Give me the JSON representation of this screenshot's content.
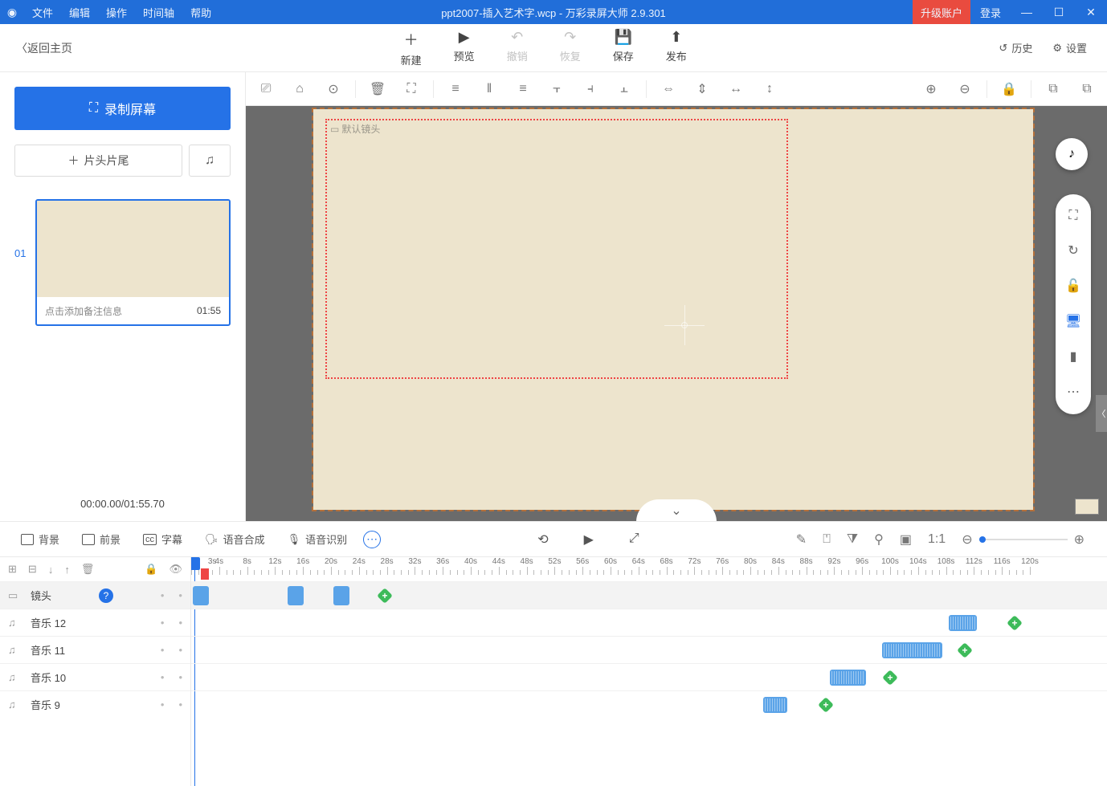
{
  "titlebar": {
    "menus": [
      "文件",
      "编辑",
      "操作",
      "时间轴",
      "帮助"
    ],
    "title": "ppt2007-插入艺术字.wcp - 万彩录屏大师 2.9.301",
    "upgrade": "升级账户",
    "login": "登录"
  },
  "maintb": {
    "back": "返回主页",
    "items": [
      {
        "icon": "＋",
        "label": "新建"
      },
      {
        "icon": "▶",
        "label": "预览"
      },
      {
        "icon": "↶",
        "label": "撤销",
        "disabled": true
      },
      {
        "icon": "↷",
        "label": "恢复",
        "disabled": true
      },
      {
        "icon": "💾",
        "label": "保存"
      },
      {
        "icon": "⬆",
        "label": "发布"
      }
    ],
    "history": "历史",
    "settings": "设置"
  },
  "left": {
    "record": "录制屏幕",
    "titles": "片头片尾",
    "scene_num": "01",
    "note_placeholder": "点击添加备注信息",
    "scene_time": "01:55",
    "time_status": "00:00.00/01:55.70"
  },
  "canvas": {
    "default_shot": "默认镜头"
  },
  "timeline": {
    "tabs": [
      "背景",
      "前景",
      "字幕",
      "语音合成",
      "语音识别"
    ],
    "ruler_labels": [
      "3s",
      "4s",
      "8s",
      "12s",
      "16s",
      "20s",
      "24s",
      "28s",
      "32s",
      "36s",
      "40s",
      "44s",
      "48s",
      "52s",
      "56s",
      "60s",
      "64s",
      "68s",
      "72s",
      "76s",
      "80s",
      "84s",
      "88s",
      "92s",
      "96s",
      "100s",
      "104s",
      "108s",
      "112s",
      "116s"
    ],
    "tracks": [
      {
        "icon": "cam",
        "name": "镜头",
        "first": true,
        "help": true
      },
      {
        "icon": "note",
        "name": "音乐 12"
      },
      {
        "icon": "note",
        "name": "音乐 11"
      },
      {
        "icon": "note",
        "name": "音乐 10"
      },
      {
        "icon": "note",
        "name": "音乐 9"
      }
    ]
  }
}
